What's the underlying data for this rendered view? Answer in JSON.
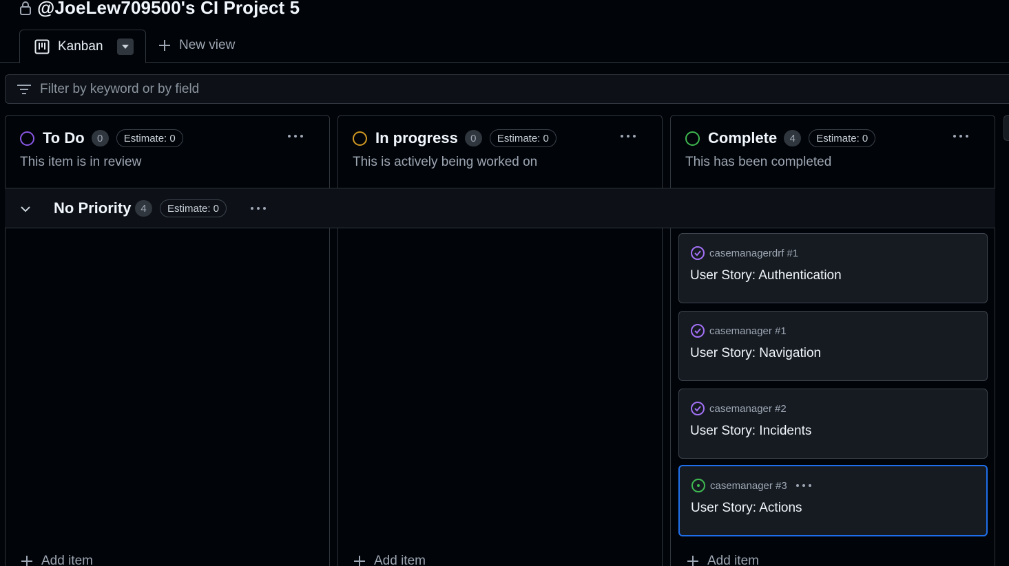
{
  "project": {
    "title": "@JoeLew709500's CI Project 5"
  },
  "views": {
    "active_tab": "Kanban",
    "new_view_label": "New view"
  },
  "filter": {
    "placeholder": "Filter by keyword or by field"
  },
  "columns": [
    {
      "name": "To Do",
      "count": "0",
      "estimate": "Estimate: 0",
      "description": "This item is in review",
      "color": "#8957e5"
    },
    {
      "name": "In progress",
      "count": "0",
      "estimate": "Estimate: 0",
      "description": "This is actively being worked on",
      "color": "#d29922"
    },
    {
      "name": "Complete",
      "count": "4",
      "estimate": "Estimate: 0",
      "description": "This has been completed",
      "color": "#3fb950"
    }
  ],
  "group": {
    "name": "No Priority",
    "count": "4",
    "estimate": "Estimate: 0"
  },
  "cards": [
    {
      "ref": "casemanagerdrf #1",
      "title": "User Story: Authentication",
      "status": "closed"
    },
    {
      "ref": "casemanager #1",
      "title": "User Story: Navigation",
      "status": "closed"
    },
    {
      "ref": "casemanager #2",
      "title": "User Story: Incidents",
      "status": "closed"
    },
    {
      "ref": "casemanager #3",
      "title": "User Story: Actions",
      "status": "open"
    }
  ],
  "add_item_label": "Add item",
  "colors": {
    "accent_selected": "#1f6feb",
    "closed_issue": "#a371f7",
    "open_issue": "#3fb950"
  }
}
